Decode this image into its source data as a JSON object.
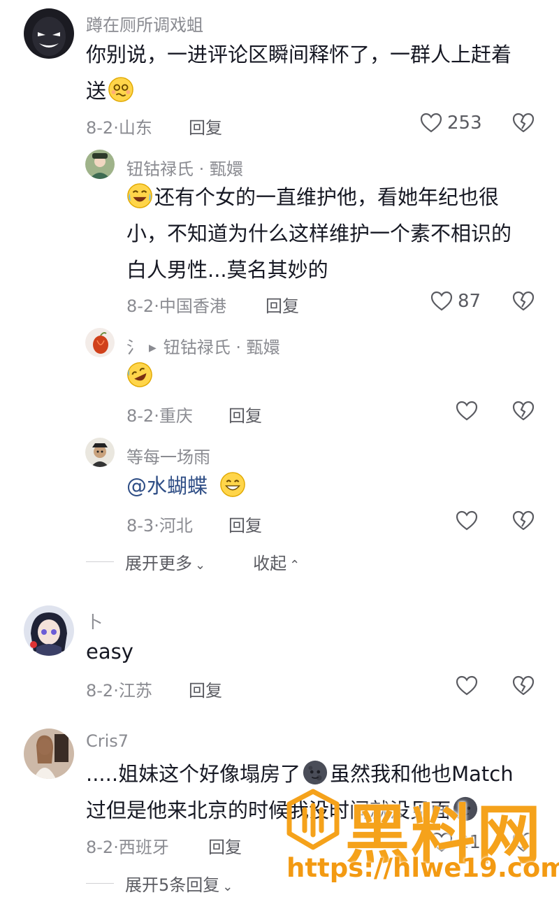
{
  "comments": [
    {
      "username": "蹲在厕所调戏蛆",
      "text_line1": "你别说，一进评论区瞬间释怀了，一群人上赶着",
      "text_line2": "送",
      "date": "8-2",
      "location": "山东",
      "reply_label": "回复",
      "likes": "253"
    },
    {
      "username": "钮钴禄氏 · 甄嬛",
      "text_line1": "还有个女的一直维护他，看她年纪也很",
      "text_line2": "小，不知道为什么这样维护一个素不相识的",
      "text_line3": "白人男性...莫名其妙的",
      "date": "8-2",
      "location": "中国香港",
      "reply_label": "回复",
      "likes": "87"
    },
    {
      "username": "氵",
      "reply_to": "钮钴禄氏 · 甄嬛",
      "date": "8-2",
      "location": "重庆",
      "reply_label": "回复"
    },
    {
      "username": "等每一场雨",
      "mention": "@水蝴蝶",
      "date": "8-3",
      "location": "河北",
      "reply_label": "回复"
    },
    {
      "username": "卜",
      "text_line1": "easy",
      "date": "8-2",
      "location": "江苏",
      "reply_label": "回复"
    },
    {
      "username": "Cris7",
      "text_line1a": ".....姐妹这个好像塌房了",
      "text_line1b": "虽然我和他也Match",
      "text_line2": "过但是他来北京的时候我没时间就没见面",
      "date": "8-2",
      "location": "西班牙",
      "reply_label": "回复",
      "likes": "21"
    }
  ],
  "thread_controls": {
    "expand_more": "展开更多",
    "collapse": "收起",
    "expand_replies": "展开5条回复"
  },
  "watermark": {
    "title": "黑料网",
    "url": "https://hlwe19.com"
  },
  "colors": {
    "primary_text": "#161823",
    "secondary_text": "#8a8b91",
    "mention": "#2f4e86",
    "watermark": "#f5a21b"
  }
}
